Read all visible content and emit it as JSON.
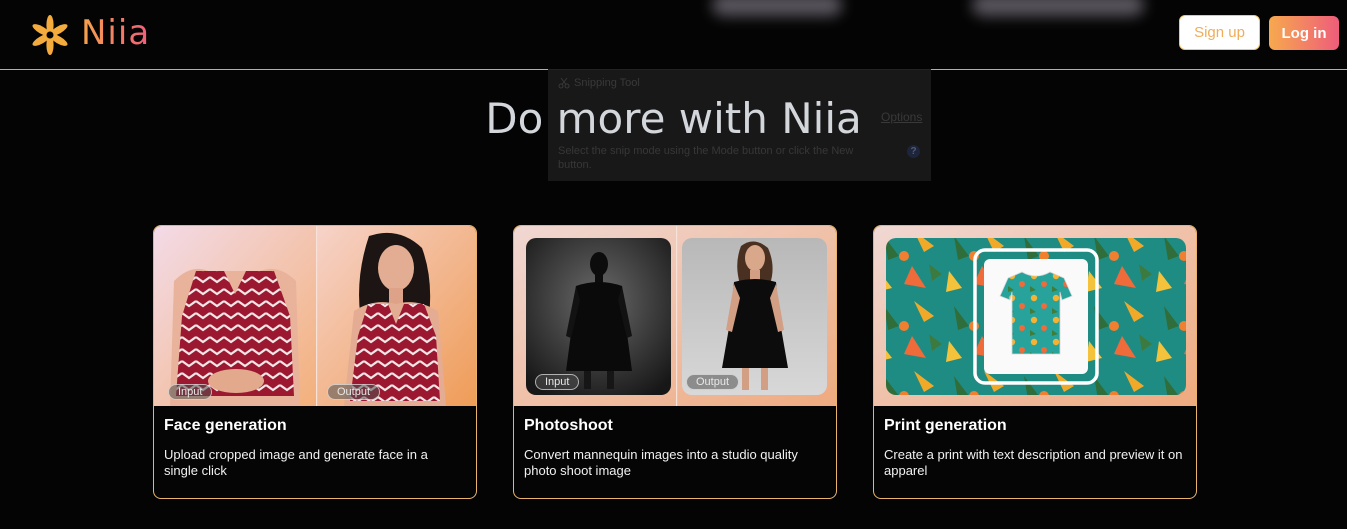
{
  "brand": {
    "name": "Niia"
  },
  "header": {
    "signup_label": "Sign up",
    "login_label": "Log in"
  },
  "snipping_tool": {
    "title": "Snipping Tool",
    "options": "Options",
    "help": "?",
    "description": "Select the snip mode using the Mode button or click the New button."
  },
  "main": {
    "headline": "Do more with Niia",
    "cards": [
      {
        "title": "Face generation",
        "description": "Upload cropped image and generate face in a single click",
        "input_tag": "Input",
        "output_tag": "Output"
      },
      {
        "title": "Photoshoot",
        "description": "Convert mannequin images into a studio quality photo shoot image",
        "input_tag": "Input",
        "output_tag": "Output"
      },
      {
        "title": "Print generation",
        "description": "Create a print with text description and preview it on apparel"
      }
    ]
  },
  "colors": {
    "accent_orange": "#f6a34c",
    "accent_pink": "#ef5d7c",
    "background": "#040404",
    "card_border": "#e9b46a"
  }
}
